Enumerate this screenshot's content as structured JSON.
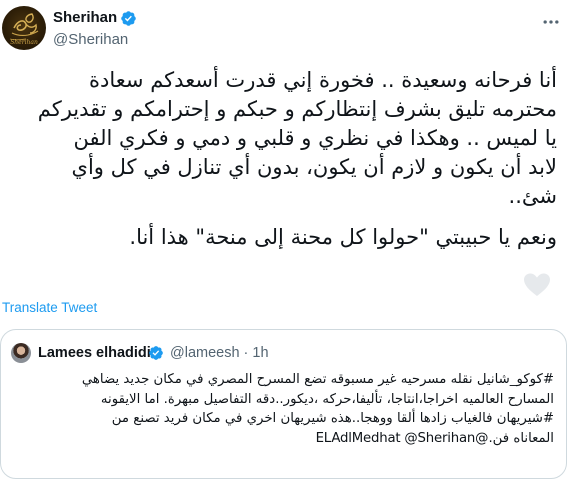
{
  "author": {
    "display_name": "Sherihan",
    "handle": "@Sherihan",
    "avatar_logo_text": "Sherihan",
    "verified": true
  },
  "menu": {
    "more_icon": "more-horizontal-icon"
  },
  "tweet": {
    "lines": [
      "أنا فرحانه وسعيدة .. فخورة إني قدرت أسعدكم سعادة",
      "محترمه تليق بشرف إنتظاركم و حبكم و إحترامكم و تقديركم",
      "يا لميس .. وهكذا في نظري و قلبي و دمي و فكري الفن",
      "لابد أن يكون و لازم أن يكون، بدون أي تنازل في كل وأي",
      "شئ..",
      "ونعم يا حبيبتي \"حولوا كل محنة إلى منحة\" هذا أنا."
    ],
    "translate_label": "Translate Tweet",
    "heart_icon": "heart-icon"
  },
  "quote": {
    "display_name": "Lamees elhadidi",
    "handle_time": "@lameesh · 1h",
    "verified": true,
    "lines": [
      "#كوكو_شانيل نقله مسرحيه غير مسبوقه تضع المسرح المصري في مكان جديد يضاهي",
      "المسارح العالميه اخراجا،انتاجا، تأليفا،حركه ،ديكور..دقه التفاصيل مبهرة. اما الايقونه",
      "#شيريهان فالغياب زادها ألقا ووهجا..هذه شيريهان اخري في مكان فريد تصنع من",
      "المعاناه فن.@ELAdlMedhat @Sherihan"
    ]
  },
  "colors": {
    "text": "#0f1419",
    "secondary": "#536471",
    "link": "#1d9bf0",
    "verified": "#1d9bf0",
    "border": "#cfd9de",
    "avatar_gold": "#c9a24a"
  }
}
